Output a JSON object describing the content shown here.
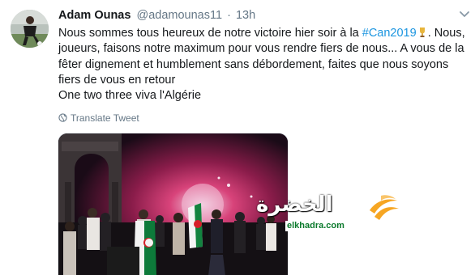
{
  "tweet": {
    "author_name": "Adam Ounas",
    "author_handle": "@adamounas11",
    "separator": "·",
    "timestamp": "13h",
    "text_before_hashtag": "Nous sommes tous heureux de notre victoire hier soir à la ",
    "hashtag": "#Can2019",
    "text_after_hashtag": ". Nous, joueurs, faisons notre maximum pour vous rendre fiers de nous... A vous de la fêter dignement et humblement sans débordement, faites que nous soyons fiers de vous en retour",
    "text_line2": "One two three viva l'Algérie",
    "translate_label": "Translate Tweet"
  },
  "watermark": {
    "arabic": "الخضرة",
    "site": "elkhadra.com"
  },
  "icons": {
    "trophy": "trophy-emoji-icon",
    "globe": "globe-icon",
    "chevron": "chevron-down-icon"
  },
  "colors": {
    "link": "#1b95e0",
    "secondary": "#657786",
    "watermark_green": "#0b7a2c",
    "watermark_orange": "#f6a623"
  }
}
